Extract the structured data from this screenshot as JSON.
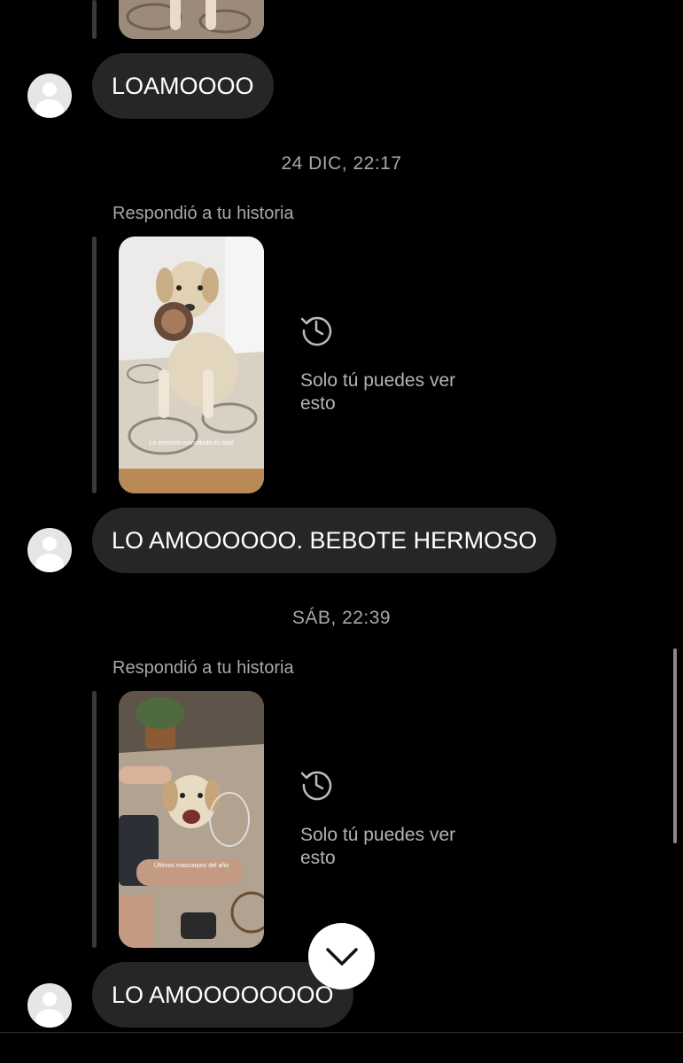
{
  "messages": [
    {
      "text": "LOAMOOOO"
    },
    {
      "text": "LO AMOOOOOO. BEBOTE HERMOSO"
    },
    {
      "text": "LO AMOOOOOOOO"
    }
  ],
  "timestamps": [
    "24 DIC, 22:17",
    "SÁB, 22:39"
  ],
  "story_replies": [
    {
      "label": "Respondió a tu historia",
      "private_note": "Solo tú puedes ver esto",
      "caption": "La emoción mandíbula es total"
    },
    {
      "label": "Respondió a tu historia",
      "private_note": "Solo tú puedes ver esto",
      "caption": "Últimos mascarpos del año"
    }
  ],
  "icons": {
    "avatar": "default-profile-icon",
    "private": "history-clock-icon",
    "scroll_down": "chevron-down-icon"
  },
  "colors": {
    "bubble": "#262626",
    "muted_text": "#a8a8a8",
    "background": "#000000"
  }
}
